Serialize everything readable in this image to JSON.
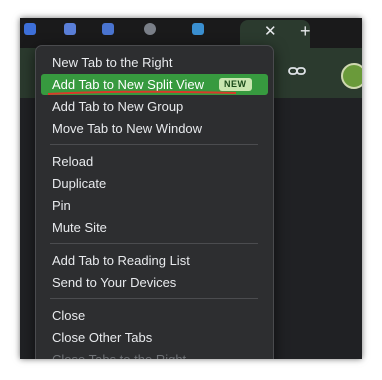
{
  "browser": {
    "tab_close_glyph": "✕",
    "new_tab_glyph": "+",
    "toolbar_icons": [
      "download-icon",
      "link-icon"
    ],
    "accent_color": "#379a3f",
    "badge_color": "#c9e6b0"
  },
  "menu": {
    "items": [
      {
        "label": "New Tab to the Right"
      },
      {
        "label": "Add Tab to New Split View",
        "badge": "NEW",
        "highlighted": true
      },
      {
        "label": "Add Tab to New Group"
      },
      {
        "label": "Move Tab to New Window"
      },
      {
        "label": "Reload"
      },
      {
        "label": "Duplicate"
      },
      {
        "label": "Pin"
      },
      {
        "label": "Mute Site"
      },
      {
        "label": "Add Tab to Reading List"
      },
      {
        "label": "Send to Your Devices"
      },
      {
        "label": "Close"
      },
      {
        "label": "Close Other Tabs"
      },
      {
        "label": "Close Tabs to the Right",
        "disabled": true
      }
    ]
  }
}
